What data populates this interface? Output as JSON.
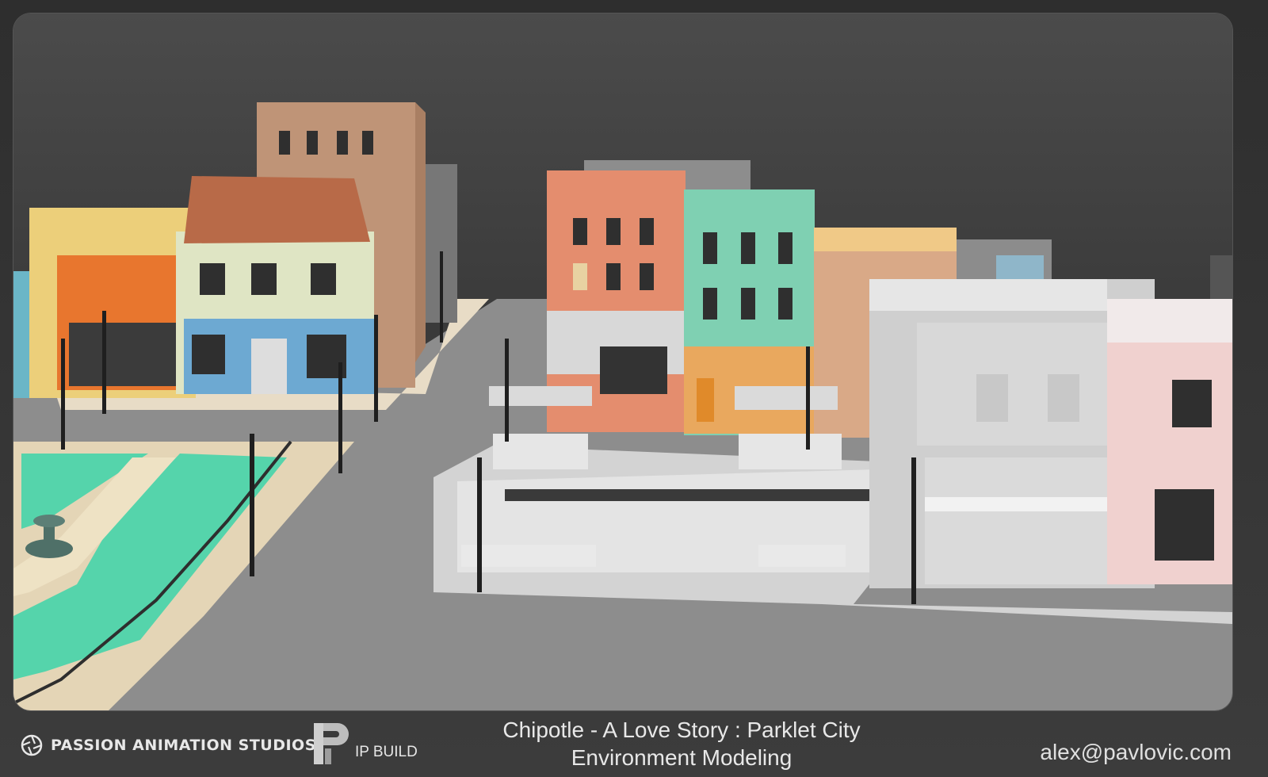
{
  "footer": {
    "studio_name": "PASSION ANIMATION STUDIOS",
    "ip_label": "IP BUILD",
    "title_line1": "Chipotle - A Love Story : Parklet City",
    "title_line2": "Environment Modeling",
    "email": "alex@pavlovic.com"
  },
  "icons": {
    "studio_logo": "aperture-icon",
    "ip_logo": "p-letter-logo"
  }
}
